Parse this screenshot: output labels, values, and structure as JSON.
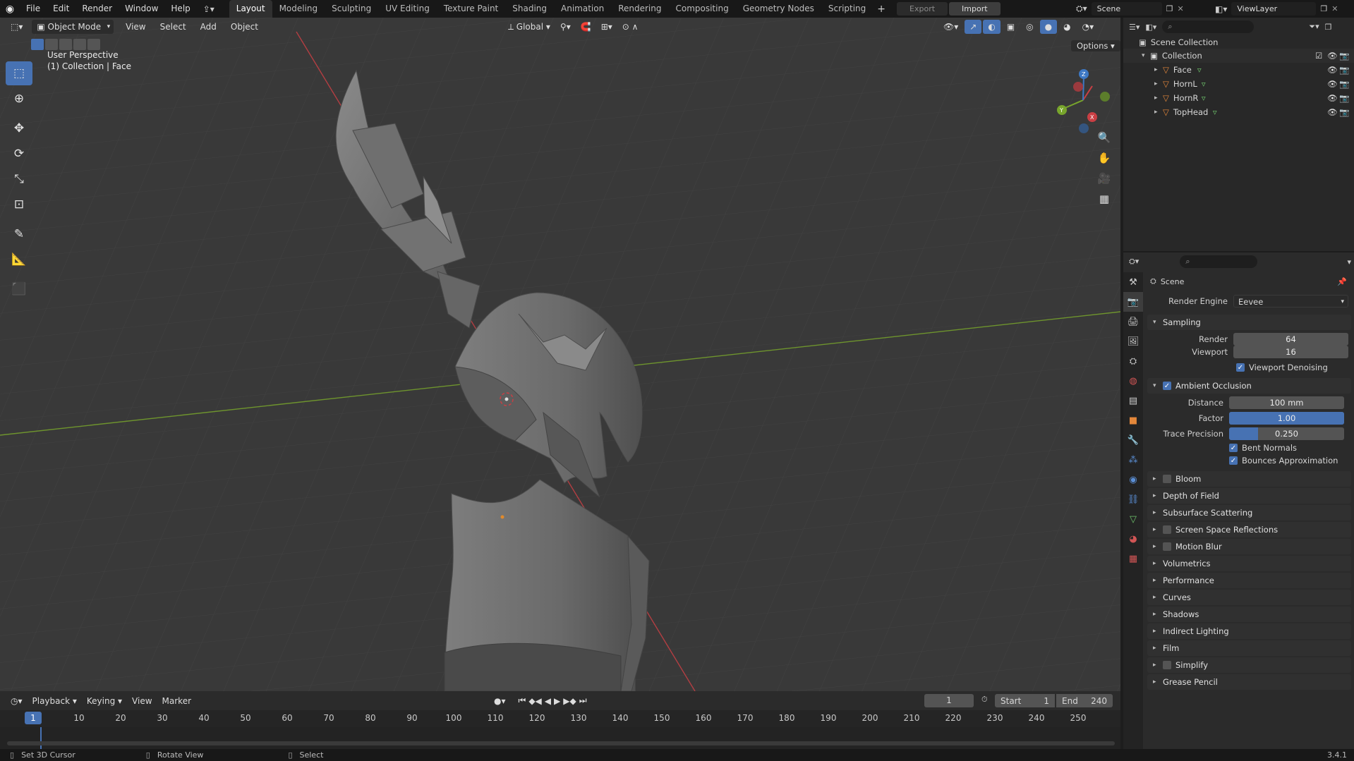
{
  "topbar": {
    "menus": [
      "File",
      "Edit",
      "Render",
      "Window",
      "Help"
    ],
    "workspaces": [
      "Layout",
      "Modeling",
      "Sculpting",
      "UV Editing",
      "Texture Paint",
      "Shading",
      "Animation",
      "Rendering",
      "Compositing",
      "Geometry Nodes",
      "Scripting"
    ],
    "active_workspace": "Layout",
    "export_label": "Export",
    "import_label": "Import",
    "scene_name": "Scene",
    "view_layer": "ViewLayer"
  },
  "viewport": {
    "mode": "Object Mode",
    "menus": [
      "View",
      "Select",
      "Add",
      "Object"
    ],
    "orientation": "Global",
    "options_label": "Options",
    "overlay_line1": "User Perspective",
    "overlay_line2": "(1) Collection | Face",
    "gizmo_axes": [
      "X",
      "Y",
      "Z"
    ]
  },
  "timeline": {
    "menus": [
      "Playback",
      "Keying",
      "View",
      "Marker"
    ],
    "current_frame": "1",
    "start_label": "Start",
    "start": "1",
    "end_label": "End",
    "end": "240",
    "ticks": [
      "1",
      "10",
      "20",
      "30",
      "40",
      "50",
      "60",
      "70",
      "80",
      "90",
      "100",
      "110",
      "120",
      "130",
      "140",
      "150",
      "160",
      "170",
      "180",
      "190",
      "200",
      "210",
      "220",
      "230",
      "240",
      "250"
    ]
  },
  "statusbar": {
    "items": [
      "Set 3D Cursor",
      "Rotate View",
      "Select"
    ],
    "version": "3.4.1"
  },
  "outliner": {
    "scene_collection": "Scene Collection",
    "collection": "Collection",
    "objects": [
      "Face",
      "HornL",
      "HornR",
      "TopHead"
    ]
  },
  "properties": {
    "context": "Scene",
    "render_engine_label": "Render Engine",
    "render_engine": "Eevee",
    "sampling": {
      "title": "Sampling",
      "render_label": "Render",
      "render": "64",
      "viewport_label": "Viewport",
      "viewport": "16",
      "denoise_label": "Viewport Denoising"
    },
    "ao": {
      "title": "Ambient Occlusion",
      "distance_label": "Distance",
      "distance": "100 mm",
      "factor_label": "Factor",
      "factor": "1.00",
      "factor_fill": 1.0,
      "trace_label": "Trace Precision",
      "trace": "0.250",
      "trace_fill": 0.25,
      "bent_label": "Bent Normals",
      "bounces_label": "Bounces Approximation"
    },
    "panels": [
      {
        "label": "Bloom",
        "checkbox": true
      },
      {
        "label": "Depth of Field",
        "checkbox": false
      },
      {
        "label": "Subsurface Scattering",
        "checkbox": false
      },
      {
        "label": "Screen Space Reflections",
        "checkbox": true
      },
      {
        "label": "Motion Blur",
        "checkbox": true
      },
      {
        "label": "Volumetrics",
        "checkbox": false
      },
      {
        "label": "Performance",
        "checkbox": false
      },
      {
        "label": "Curves",
        "checkbox": false
      },
      {
        "label": "Shadows",
        "checkbox": false
      },
      {
        "label": "Indirect Lighting",
        "checkbox": false
      },
      {
        "label": "Film",
        "checkbox": false
      },
      {
        "label": "Simplify",
        "checkbox": true
      },
      {
        "label": "Grease Pencil",
        "checkbox": false
      }
    ]
  },
  "colors": {
    "accent": "#4772b3",
    "x_axis": "#c93f44",
    "y_axis": "#78a52c",
    "z_axis": "#3d78c4"
  }
}
